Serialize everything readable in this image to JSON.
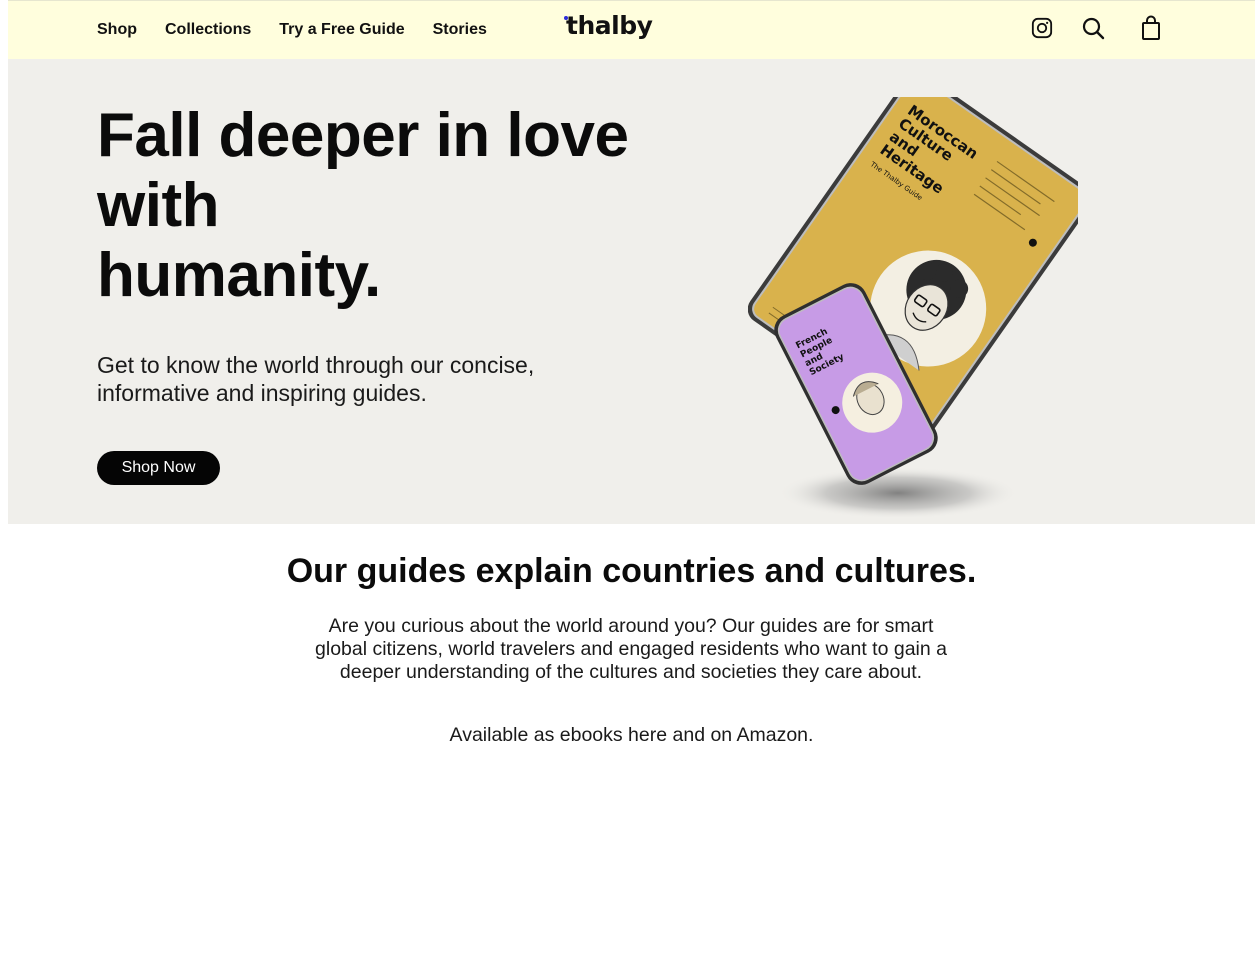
{
  "header": {
    "nav": [
      "Shop",
      "Collections",
      "Try a Free Guide",
      "Stories"
    ],
    "logo": "thalby",
    "icons": [
      "instagram-icon",
      "search-icon",
      "bag-icon"
    ]
  },
  "hero": {
    "title_lines": [
      "Fall deeper in love",
      "with",
      "humanity."
    ],
    "subtitle": "Get to know the world through our concise, informative and inspiring guides.",
    "cta": "Shop Now",
    "tablet": {
      "title": [
        "Moroccan",
        "Culture",
        "and",
        "Heritage"
      ],
      "subtitle": "The Thalby Guide"
    },
    "phone": {
      "title": [
        "French",
        "People",
        "and",
        "Society"
      ]
    }
  },
  "section": {
    "title": "Our guides explain countries and cultures.",
    "body": "Are you curious about the world around you? Our guides are for smart global citizens, world travelers and engaged residents who want to gain a deeper understanding of the cultures and societies they care about.",
    "availability": "Available as ebooks here and on Amazon."
  },
  "colors": {
    "header_bg": "#fffedd",
    "hero_bg": "#f0efeb",
    "button_bg": "#050505",
    "tablet_cover": "#d9b24c",
    "phone_cover": "#c79be6",
    "logo_dot": "#2b2bd8"
  }
}
